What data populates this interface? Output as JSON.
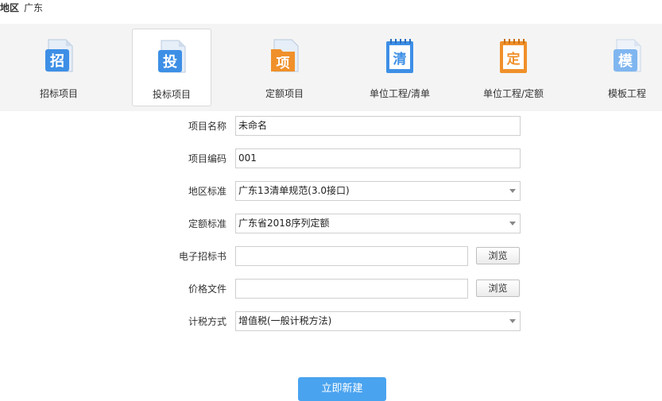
{
  "region": {
    "label": "地区",
    "value": "广东"
  },
  "project_types": [
    {
      "glyph": "招",
      "label": "招标项目",
      "color": "#3d8fe6",
      "icon": "document-icon"
    },
    {
      "glyph": "投",
      "label": "投标项目",
      "color": "#3d8fe6",
      "icon": "document-icon"
    },
    {
      "glyph": "项",
      "label": "定额项目",
      "color": "#f0902a",
      "icon": "folder-icon"
    },
    {
      "glyph": "清",
      "label": "单位工程/清单",
      "color": "#3d8fe6",
      "icon": "notebook-icon"
    },
    {
      "glyph": "定",
      "label": "单位工程/定额",
      "color": "#f0902a",
      "icon": "notebook-icon"
    },
    {
      "glyph": "模",
      "label": "模板工程",
      "color": "#7fb6f0",
      "icon": "document-icon"
    }
  ],
  "selected_type": "投标项目",
  "form": {
    "project_name": {
      "label": "项目名称",
      "value": "未命名"
    },
    "project_code": {
      "label": "项目编码",
      "value": "001"
    },
    "region_standard": {
      "label": "地区标准",
      "value": "广东13清单规范(3.0接口)"
    },
    "quota_standard": {
      "label": "定额标准",
      "value": "广东省2018序列定额"
    },
    "e_tender": {
      "label": "电子招标书",
      "value": "",
      "button": "浏览"
    },
    "price_file": {
      "label": "价格文件",
      "value": "",
      "button": "浏览"
    },
    "tax_method": {
      "label": "计税方式",
      "value": "增值税(一般计税方法)"
    }
  },
  "submit_label": "立即新建"
}
